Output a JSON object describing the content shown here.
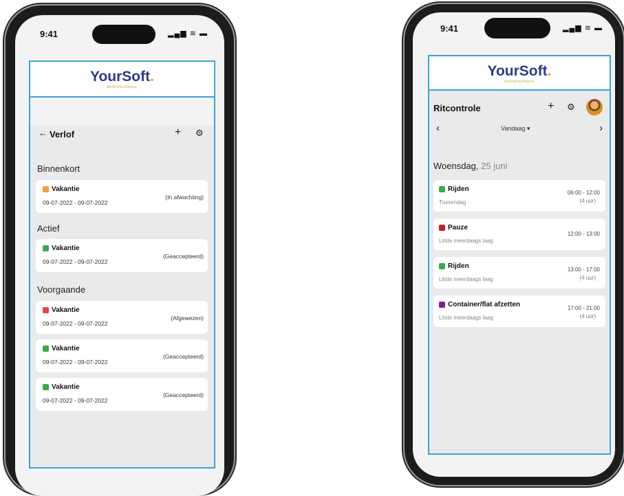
{
  "left_phone": {
    "status_time": "9:41",
    "status_icons": "▂▄▆ ≋ ▬",
    "logo_text": "YourSoft",
    "logo_dot": ".",
    "tagline": "Bedrijfssoftware",
    "back_icon": "←",
    "title": "Verlof",
    "add_icon": "+",
    "filter_icon": "⚙",
    "sections": [
      {
        "label": "Binnenkort"
      },
      {
        "label": "Actief"
      },
      {
        "label": "Voorgaande"
      }
    ],
    "cards": [
      {
        "name": "Vakantie",
        "dates": "09-07-2022 - 09-07-2022",
        "status": "(In afwachting)",
        "color": "#f0a040"
      },
      {
        "name": "Vakantie",
        "dates": "09-07-2022 - 09-07-2022",
        "status": "(Geaccepteerd)",
        "color": "#3aaa4a"
      },
      {
        "name": "Vakantie",
        "dates": "09-07-2022 - 09-07-2022",
        "status": "(Afgewezen)",
        "color": "#e04848"
      },
      {
        "name": "Vakantie",
        "dates": "09-07-2022 - 09-07-2022",
        "status": "(Geaccepteerd)",
        "color": "#3aaa4a"
      },
      {
        "name": "Vakantie",
        "dates": "09-07-2022 - 09-07-2022",
        "status": "(Geaccepteerd)",
        "color": "#3aaa4a"
      }
    ]
  },
  "right_phone": {
    "status_time": "9:41",
    "status_icons": "▂▄▆ ≋ ▬",
    "logo_text": "YourSoft",
    "logo_dot": ".",
    "tagline": "Bedrijfssoftware",
    "title": "Ritcontrole",
    "add_icon": "+",
    "filter_icon": "⚙",
    "prev_icon": "‹",
    "period": "Vandaag ▾",
    "next_icon": "›",
    "date_weekday": "Woensdag,",
    "date_day": " 25 juni",
    "entries": [
      {
        "name": "Rijden",
        "sub": "Tussendag",
        "time": "06:00 - 12:00",
        "duration": "(4 uur)",
        "color": "#3aaa4a"
      },
      {
        "name": "Pauze",
        "sub": "Litste meerdaags laag",
        "time": "12:00 - 13:00",
        "duration": "",
        "color": "#c8202a"
      },
      {
        "name": "Rijden",
        "sub": "Litste meerdaags laag",
        "time": "13:00 - 17:00",
        "duration": "(4 uur)",
        "color": "#3aaa4a"
      },
      {
        "name": "Container/flat afzetten",
        "sub": "Litste meerdaags laag",
        "time": "17:00 - 21:00",
        "duration": "(4 uur)",
        "color": "#7a1fa0"
      }
    ]
  }
}
